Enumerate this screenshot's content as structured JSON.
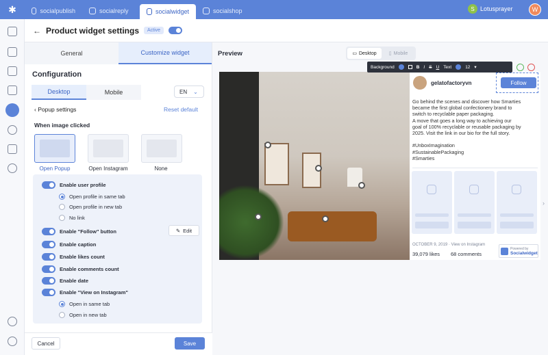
{
  "topbar": {
    "tabs": [
      {
        "label": "socialpublish",
        "icon": "publish-icon"
      },
      {
        "label": "socialreply",
        "icon": "reply-icon"
      },
      {
        "label": "socialwidget",
        "icon": "widget-icon",
        "active": true
      },
      {
        "label": "socialshop",
        "icon": "shop-icon"
      }
    ],
    "store_name": "Lotusprayer",
    "avatar_letter": "W"
  },
  "header": {
    "back": "←",
    "title": "Product widget settings",
    "status": "Active"
  },
  "left": {
    "tabs": {
      "general": "General",
      "customize": "Customize widget"
    },
    "config_title": "Configuration",
    "device_tabs": {
      "desktop": "Desktop",
      "mobile": "Mobile"
    },
    "language": "EN",
    "popup_title": "Popup settings",
    "reset": "Reset default",
    "when_clicked": "When image clicked",
    "click_options": [
      "Open Popup",
      "Open Instagram",
      "None"
    ],
    "settings": {
      "user_profile": "Enable user profile",
      "profile_same": "Open profile in same tab",
      "profile_new": "Open profile in new tab",
      "no_link": "No link",
      "follow": "Enable \"Follow\" button",
      "edit": "Edit",
      "caption": "Enable caption",
      "likes": "Enable likes count",
      "comments": "Enable comments count",
      "date": "Enable date",
      "view_on_ig": "Enable \"View on Instagram\"",
      "same_tab": "Open in same tab",
      "new_tab": "Open in new tab"
    },
    "cancel": "Cancel",
    "save": "Save"
  },
  "preview": {
    "label": "Preview",
    "modes": {
      "desktop": "Desktop",
      "mobile": "Mobile"
    },
    "toolbar": {
      "background": "Background",
      "bold": "B",
      "italic": "I",
      "strike": "S",
      "underline": "U",
      "text": "Text",
      "size": "12"
    },
    "post": {
      "username": "gelatofactoryvn",
      "follow": "Follow",
      "caption": "Go behind the scenes and discover how Smarties\nbecame the first global confectionery brand to\nswitch to recyclable paper packaging.\nA move that goes a long way to achieving our\ngoal of 100% recyclable or reusable packaging by\n2025. Visit the link in our bio for the full story.\n\n#UnboxImagination\n#SustainablePackaging\n#Smarties",
      "date": "OCTOBER 9, 2019 · View on Instagram",
      "likes": "39,079 likes",
      "comments": "68 comments",
      "powered_by": "Powered by",
      "brand": "Socialwidget"
    }
  },
  "colors": {
    "accent": "#5b83d8",
    "topbar": "#5b83d8"
  }
}
